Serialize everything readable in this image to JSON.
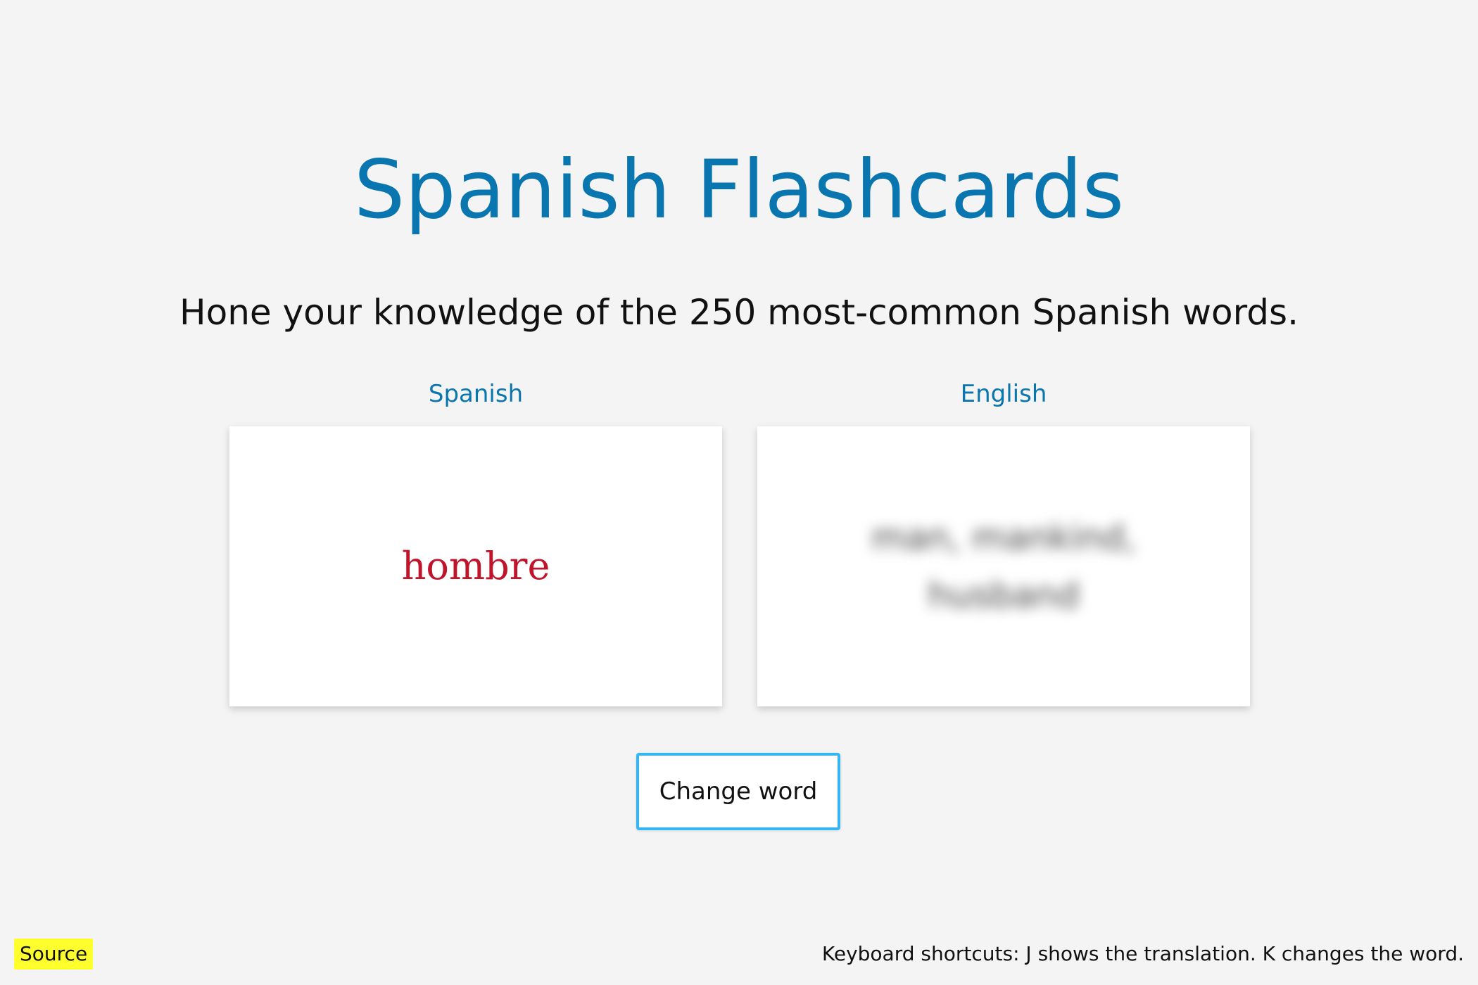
{
  "page": {
    "title": "Spanish Flashcards",
    "subtitle": "Hone your knowledge of the 250 most-common Spanish words."
  },
  "cards": {
    "spanish": {
      "label": "Spanish",
      "word": "hombre",
      "color": "#c0142b"
    },
    "english": {
      "label": "English",
      "translation": "man, mankind, husband",
      "hidden": true
    }
  },
  "controls": {
    "change_word_label": "Change word"
  },
  "footer": {
    "source_label": "Source",
    "shortcuts_text": "Keyboard shortcuts: J shows the translation. K changes the word."
  },
  "colors": {
    "accent": "#0a76b0",
    "button_border": "#35b6f2",
    "source_highlight": "#ffff2e",
    "background": "#f4f4f4"
  }
}
